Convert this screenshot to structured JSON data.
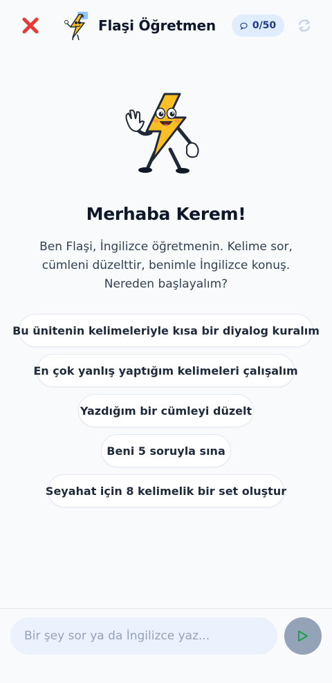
{
  "header": {
    "title": "Flaşi Öğretmen",
    "counter": "0/50",
    "icons": {
      "close": "close-icon",
      "mascot": "mascot-icon",
      "counter": "chat-bubble-icon",
      "refresh": "refresh-icon"
    }
  },
  "welcome": {
    "greeting": "Merhaba Kerem!",
    "intro": "Ben Flaşi, İngilizce öğretmenin. Kelime sor, cümleni düzelttir, benimle İngilizce konuş. Nereden başlayalım?"
  },
  "suggestions": [
    "Bu ünitenin kelimeleriyle kısa bir diyalog kuralım",
    "En çok yanlış yaptığım kelimeleri çalışalım",
    "Yazdığım bir cümleyi düzelt",
    "Beni 5 soruyla sına",
    "Seyahat için 8 kelimelik bir set oluştur"
  ],
  "composer": {
    "placeholder": "Bir şey sor ya da İngilizce yaz...",
    "send_icon": "send-icon"
  },
  "colors": {
    "close": "#e53935",
    "mascot_yellow": "#fbbf24",
    "counter_bg": "#e0ecff",
    "counter_text": "#1e3a8a",
    "send_bg": "#94a3b8",
    "send_arrow": "#16a34a"
  }
}
